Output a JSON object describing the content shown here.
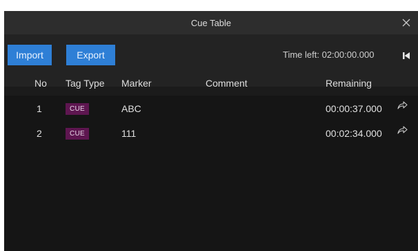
{
  "window": {
    "title": "Cue Table"
  },
  "toolbar": {
    "import_label": "Import",
    "export_label": "Export",
    "time_left": "Time left: 02:00:00.000"
  },
  "table": {
    "columns": {
      "no": "No",
      "tag_type": "Tag Type",
      "marker": "Marker",
      "comment": "Comment",
      "remaining": "Remaining"
    },
    "rows": [
      {
        "no": "1",
        "tag": "CUE",
        "marker": "ABC",
        "comment": "",
        "remaining": "00:00:37.000"
      },
      {
        "no": "2",
        "tag": "CUE",
        "marker": "111",
        "comment": "",
        "remaining": "00:02:34.000"
      }
    ]
  },
  "icons": {
    "close": "close-icon",
    "skip_back": "skip-to-start-icon",
    "share": "share-icon"
  },
  "colors": {
    "accent": "#2e7fd6",
    "tag_bg": "#5e1650",
    "background": "#1b1b1b"
  }
}
